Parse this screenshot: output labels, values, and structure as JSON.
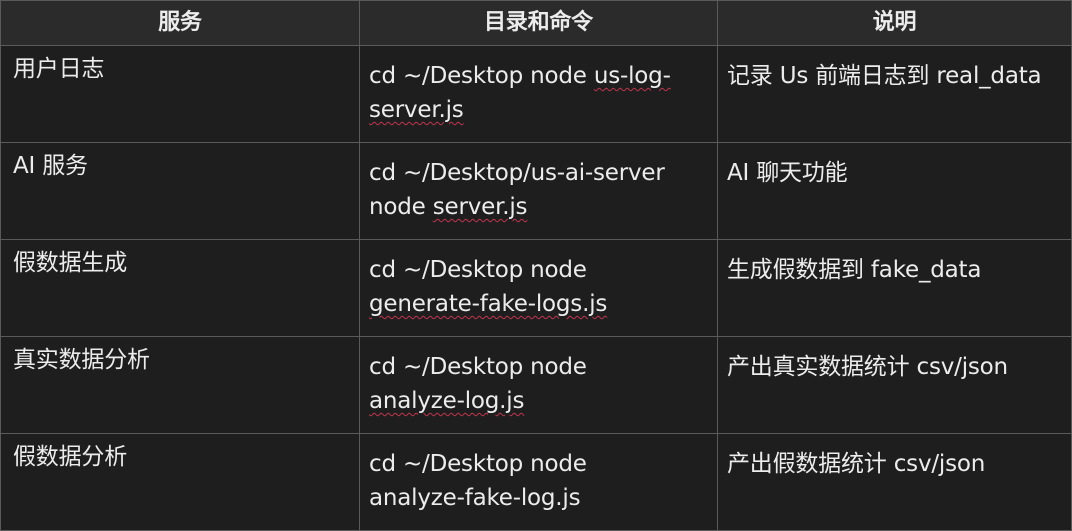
{
  "table": {
    "headers": [
      "服务",
      "目录和命令",
      "说明"
    ],
    "rows": [
      {
        "service": "用户日志",
        "command_line1_prefix": "cd ~/Desktop node ",
        "command_line1_flagged": "us-log-",
        "command_line2_flagged": "server.js",
        "command_line2_rest": "",
        "description": "记录 Us 前端日志到 real_data"
      },
      {
        "service": "AI 服务",
        "command_line1_prefix": "cd ~/Desktop/us-ai-server",
        "command_line1_flagged": "",
        "command_line2_prefix": "node ",
        "command_line2_flagged": "server.js",
        "description": "AI 聊天功能"
      },
      {
        "service": "假数据生成",
        "command_line1_prefix": "cd ~/Desktop node",
        "command_line2_flagged": "generate-fake-logs.js",
        "description": "生成假数据到 fake_data"
      },
      {
        "service": "真实数据分析",
        "command_line1_prefix": "cd ~/Desktop node",
        "command_line2_flagged": "analyze-log.js",
        "description": "产出真实数据统计 csv/json"
      },
      {
        "service": "假数据分析",
        "command_line1_prefix": "cd ~/Desktop node",
        "command_line2_plain": "analyze-fake-log.js",
        "description": "产出假数据统计 csv/json"
      }
    ]
  }
}
